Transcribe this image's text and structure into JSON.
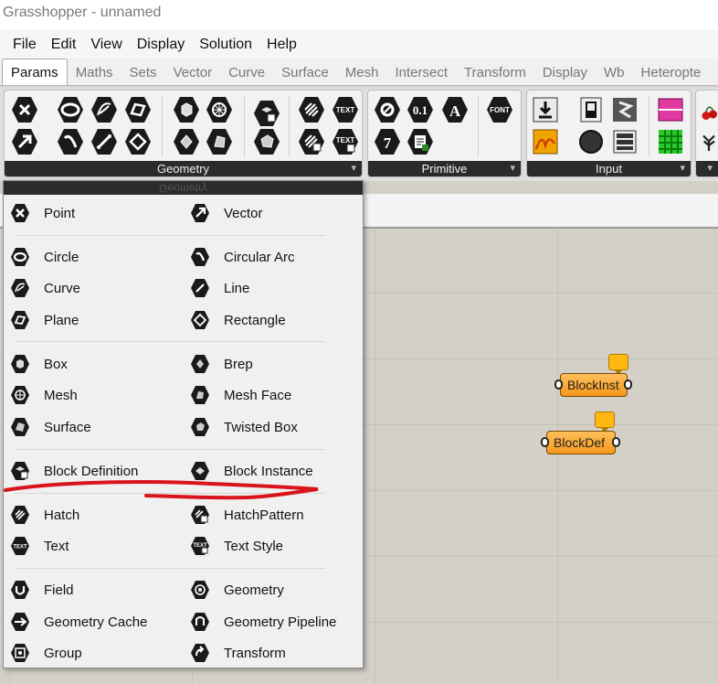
{
  "window": {
    "title": "Grasshopper - unnamed"
  },
  "menu": [
    "File",
    "Edit",
    "View",
    "Display",
    "Solution",
    "Help"
  ],
  "tabs": [
    "Params",
    "Maths",
    "Sets",
    "Vector",
    "Curve",
    "Surface",
    "Mesh",
    "Intersect",
    "Transform",
    "Display",
    "Wb",
    "Heteropte"
  ],
  "ribbon": {
    "panels": [
      {
        "label": "Geometry"
      },
      {
        "label": "Primitive"
      },
      {
        "label": "Input"
      }
    ],
    "icon_text": {
      "text": "TEXT",
      "font": "FONT",
      "zero_one": "0.1",
      "letter_a": "A",
      "seven": "7"
    }
  },
  "dropdown": {
    "header": "Geometry",
    "left": [
      {
        "label": "Point",
        "icon": "point-icon"
      },
      {
        "label": "Circle",
        "icon": "circle-icon"
      },
      {
        "label": "Curve",
        "icon": "curve-icon"
      },
      {
        "label": "Plane",
        "icon": "plane-icon"
      },
      {
        "label": "Box",
        "icon": "box-icon"
      },
      {
        "label": "Mesh",
        "icon": "mesh-icon"
      },
      {
        "label": "Surface",
        "icon": "surface-icon"
      },
      {
        "label": "Block Definition",
        "icon": "block-definition-icon"
      },
      {
        "label": "Hatch",
        "icon": "hatch-icon"
      },
      {
        "label": "Text",
        "icon": "text-icon"
      },
      {
        "label": "Field",
        "icon": "field-icon"
      },
      {
        "label": "Geometry Cache",
        "icon": "geometry-cache-icon"
      },
      {
        "label": "Group",
        "icon": "group-icon"
      }
    ],
    "right": [
      {
        "label": "Vector",
        "icon": "vector-icon"
      },
      {
        "label": "Circular Arc",
        "icon": "arc-icon"
      },
      {
        "label": "Line",
        "icon": "line-icon"
      },
      {
        "label": "Rectangle",
        "icon": "rectangle-icon"
      },
      {
        "label": "Brep",
        "icon": "brep-icon"
      },
      {
        "label": "Mesh Face",
        "icon": "mesh-face-icon"
      },
      {
        "label": "Twisted Box",
        "icon": "twisted-box-icon"
      },
      {
        "label": "Block Instance",
        "icon": "block-instance-icon"
      },
      {
        "label": "HatchPattern",
        "icon": "hatch-pattern-icon"
      },
      {
        "label": "Text Style",
        "icon": "text-style-icon"
      },
      {
        "label": "Geometry",
        "icon": "geometry-icon"
      },
      {
        "label": "Geometry Pipeline",
        "icon": "geometry-pipeline-icon"
      },
      {
        "label": "Transform",
        "icon": "transform-icon"
      }
    ]
  },
  "canvas": {
    "components": [
      {
        "label": "BlockInst"
      },
      {
        "label": "BlockDef"
      }
    ]
  },
  "colors": {
    "component": "#f6981b",
    "annotation": "#d9141b",
    "panel_label_bg": "#2b2b2b"
  }
}
